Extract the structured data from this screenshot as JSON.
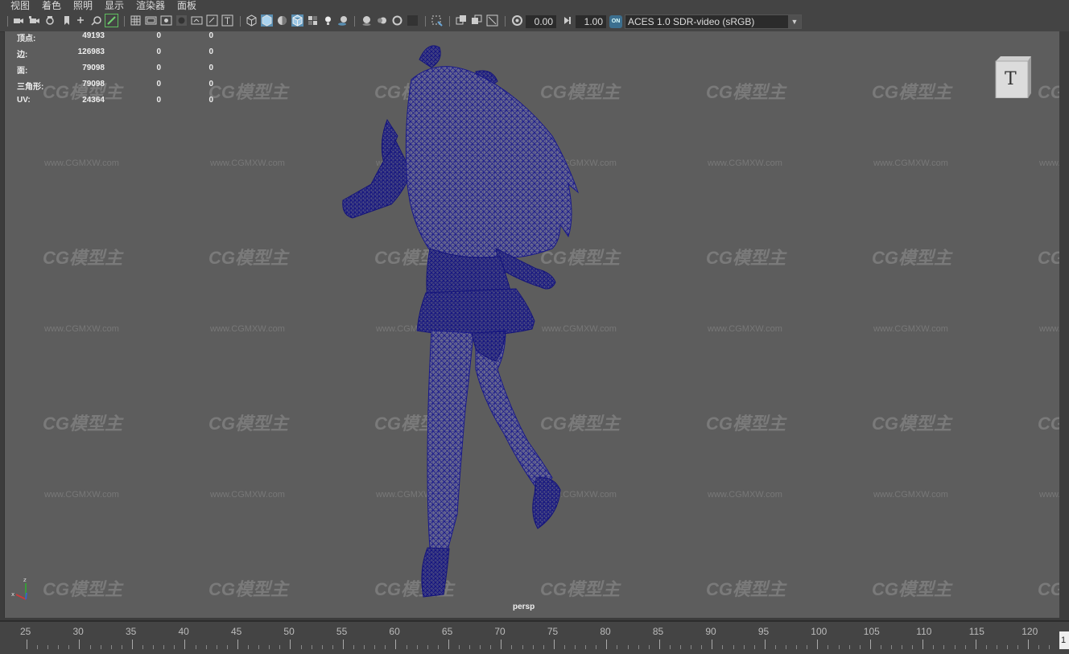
{
  "menu": [
    "视图",
    "着色",
    "照明",
    "显示",
    "渲染器",
    "面板"
  ],
  "toolbar": {
    "exposure": "0.00",
    "gamma": "1.00",
    "color_management_badge": "ON",
    "color_space": "ACES 1.0 SDR-video (sRGB)",
    "icons": [
      "select-camera-icon",
      "camera-attributes-icon",
      "bookmarks-icon",
      "image-plane-icon",
      "2d-pan-zoom-icon",
      "grease-pencil-icon",
      "grid-icon",
      "film-gate-icon",
      "resolution-gate-icon",
      "gate-mask-icon",
      "field-chart-icon",
      "safe-action-icon",
      "safe-title-icon",
      "wireframe-icon",
      "smooth-shade-icon",
      "default-material-icon",
      "textured-icon",
      "use-all-lights-icon",
      "shadows-icon",
      "screen-space-ao-icon",
      "motion-blur-icon",
      "multisample-aa-icon",
      "depth-of-field-icon",
      "isolate-select-icon",
      "xray-icon",
      "xray-active-icon",
      "xray-joints-icon",
      "exposure-icon",
      "gamma-icon"
    ]
  },
  "hud": {
    "rows": [
      {
        "label": "顶点:",
        "values": [
          "49193",
          "0",
          "0"
        ]
      },
      {
        "label": "边:",
        "values": [
          "126983",
          "0",
          "0"
        ]
      },
      {
        "label": "面:",
        "values": [
          "79098",
          "0",
          "0"
        ]
      },
      {
        "label": "三角形:",
        "values": [
          "79098",
          "0",
          "0"
        ]
      },
      {
        "label": "UV:",
        "values": [
          "24364",
          "0",
          "0"
        ]
      }
    ]
  },
  "view_cube": {
    "face_label": "T"
  },
  "camera_label": "persp",
  "watermark": {
    "logo": "CG模型主",
    "url": "www.CGMXW.com"
  },
  "timeline": {
    "ticks": [
      "25",
      "30",
      "35",
      "40",
      "45",
      "50",
      "55",
      "60",
      "65",
      "70",
      "75",
      "80",
      "85",
      "90",
      "95",
      "100",
      "105",
      "110",
      "115",
      "120"
    ],
    "current_frame": "1"
  },
  "colors": {
    "wireframe": "#1a1a8a",
    "viewport_bg": "#5d5d5d",
    "ui_bg": "#444444"
  }
}
